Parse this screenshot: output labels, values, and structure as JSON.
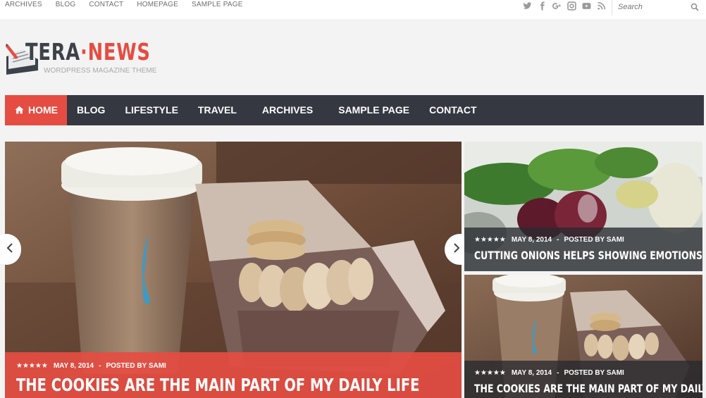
{
  "topbar": {
    "links": [
      "ARCHIVES",
      "BLOG",
      "CONTACT",
      "HOMEPAGE",
      "SAMPLE PAGE"
    ],
    "social_icons": [
      "twitter-icon",
      "facebook-icon",
      "google-plus-icon",
      "instagram-icon",
      "youtube-icon",
      "rss-icon"
    ],
    "search_placeholder": "Search"
  },
  "logo": {
    "part1": "TERA",
    "separator": "·",
    "part2": "NEWS",
    "tagline": "WORDPRESS MAGAZINE THEME"
  },
  "nav": {
    "items": [
      "HOME",
      "BLOG",
      "LIFESTYLE",
      "TRAVEL",
      "ARCHIVES",
      "SAMPLE PAGE",
      "CONTACT"
    ],
    "active_index": 0
  },
  "slider": {
    "rating": "★★★★★",
    "date": "MAY 8, 2014",
    "separator": "-",
    "author": "POSTED BY SAMI",
    "title": "THE COOKIES ARE THE MAIN PART OF MY DAILY LIFE"
  },
  "side_posts": [
    {
      "rating": "★★★★★",
      "date": "MAY 8, 2014",
      "separator": "-",
      "author": "POSTED BY SAMI",
      "title": "CUTTING ONIONS HELPS SHOWING EMOTIONS"
    },
    {
      "rating": "★★★★★",
      "date": "MAY 8, 2014",
      "separator": "-",
      "author": "POSTED BY SAMI",
      "title": "THE COOKIES ARE THE MAIN PART OF MY DAILY LIFE"
    }
  ],
  "colors": {
    "accent": "#e54d42",
    "nav_bg": "#353841",
    "logo_dark": "#3d4149"
  }
}
